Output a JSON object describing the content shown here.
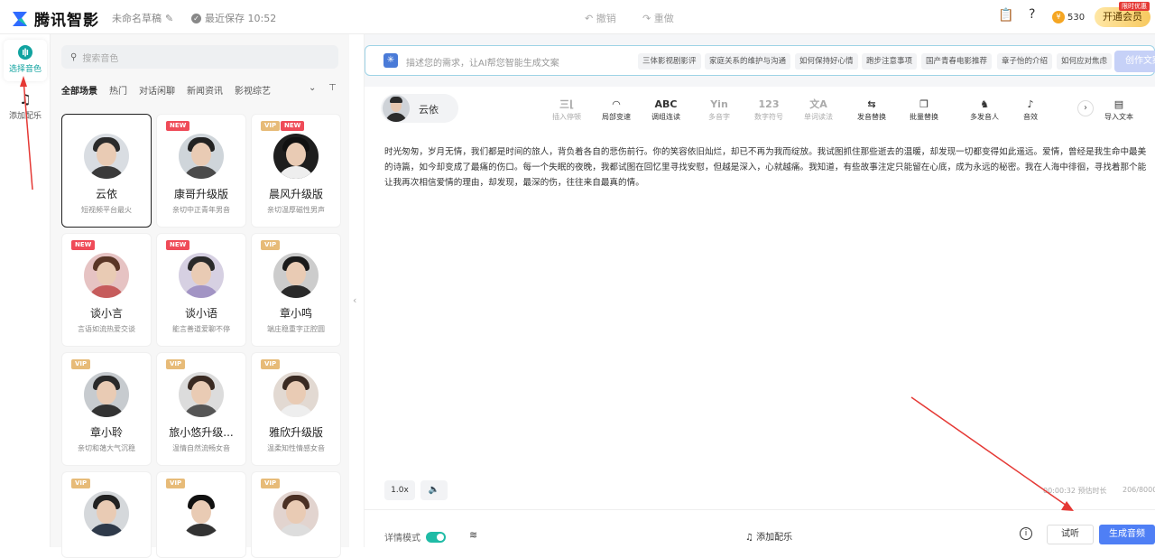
{
  "header": {
    "brand": "腾讯智影",
    "draft_name": "未命名草稿",
    "save_status": "最近保存 10:52",
    "undo": "撤销",
    "redo": "重做",
    "coins": "530",
    "vip_button": "开通会员",
    "vip_tag": "限时优惠"
  },
  "leftnav": {
    "items": [
      {
        "label": "选择音色",
        "icon": "voice-icon",
        "active": true
      },
      {
        "label": "添加配乐",
        "icon": "music-note-icon",
        "active": false
      }
    ]
  },
  "voices": {
    "search_placeholder": "搜索音色",
    "filters": [
      "全部场景",
      "热门",
      "对话闲聊",
      "新闻资讯",
      "影视综艺"
    ],
    "cards": [
      {
        "name": "云依",
        "desc": "短视频平台最火",
        "badges": [],
        "selected": true
      },
      {
        "name": "康哥升级版",
        "desc": "亲切中正青年男音",
        "badges": [
          "NEW"
        ]
      },
      {
        "name": "晨风升级版",
        "desc": "亲切温厚磁性男声",
        "badges": [
          "VIP",
          "NEW"
        ]
      },
      {
        "name": "谈小言",
        "desc": "言语如流热爱交谈",
        "badges": [
          "NEW"
        ]
      },
      {
        "name": "谈小语",
        "desc": "能言善道爱聊不停",
        "badges": [
          "NEW"
        ]
      },
      {
        "name": "章小鸣",
        "desc": "端庄稳重字正腔圆",
        "badges": [
          "VIP"
        ]
      },
      {
        "name": "章小聆",
        "desc": "亲切和蔼大气沉稳",
        "badges": [
          "VIP"
        ]
      },
      {
        "name": "旅小悠升级...",
        "desc": "温情自然流畅女音",
        "badges": [
          "VIP"
        ]
      },
      {
        "name": "雅欣升级版",
        "desc": "温柔知性情感女音",
        "badges": [
          "VIP"
        ]
      },
      {
        "name": "",
        "desc": "",
        "badges": [
          "VIP"
        ]
      },
      {
        "name": "",
        "desc": "",
        "badges": [
          "VIP"
        ]
      },
      {
        "name": "",
        "desc": "",
        "badges": [
          "VIP"
        ]
      }
    ]
  },
  "ai": {
    "placeholder": "描述您的需求，让AI帮您智能生成文案",
    "chips": [
      "三体影视剧影评",
      "家庭关系的维护与沟通",
      "如何保持好心情",
      "跑步注意事项",
      "国产青春电影推荐",
      "章子怡的介绍",
      "如何应对焦虑"
    ],
    "button": "创作文案"
  },
  "editor": {
    "speaker": "云依",
    "tools": [
      {
        "icon": "pause-insert-icon",
        "glyph": "三⌊",
        "label": "插入停顿",
        "dim": true
      },
      {
        "icon": "speed-gauge-icon",
        "glyph": "◠",
        "label": "局部变速",
        "dim": false
      },
      {
        "icon": "abc-icon",
        "glyph": "ABC",
        "label": "调组连读",
        "dim": false
      },
      {
        "icon": "pinyin-icon",
        "glyph": "Yin",
        "label": "多音字",
        "dim": true
      },
      {
        "icon": "number-icon",
        "glyph": "123",
        "label": "数字符号",
        "dim": true
      },
      {
        "icon": "translate-icon",
        "glyph": "文A",
        "label": "单词读法",
        "dim": true
      },
      {
        "icon": "swap-icon",
        "glyph": "⇆",
        "label": "发音替换",
        "dim": false
      },
      {
        "icon": "copy-icon",
        "glyph": "❐",
        "label": "批量替换",
        "dim": false
      },
      {
        "icon": "multi-speaker-icon",
        "glyph": "♞",
        "label": "多发音人",
        "dim": false
      },
      {
        "icon": "sound-effect-icon",
        "glyph": "♪",
        "label": "音效",
        "dim": false
      },
      {
        "icon": "import-icon",
        "glyph": "▤",
        "label": "导入文本",
        "dim": false
      }
    ],
    "text": "时光匆匆，岁月无情，我们都是时间的旅人，背负着各自的悲伤前行。你的笑容依旧灿烂，却已不再为我而绽放。我试图抓住那些逝去的温暖，却发现一切都变得如此遥远。爱情，曾经是我生命中最美的诗篇，如今却变成了最痛的伤口。每一个失眠的夜晚，我都试图在回忆里寻找安慰，但越是深入，心就越痛。我知道，有些故事注定只能留在心底，成为永远的秘密。我在人海中徘徊，寻找着那个能让我再次相信爱情的理由，却发现，最深的伤，往往来自最真的情。",
    "speed": "1.0x",
    "duration": "00:00:32  预估时长",
    "char_count": "206/8000"
  },
  "footer": {
    "detail_mode": "详情模式",
    "add_music": "添加配乐",
    "try_listen": "试听",
    "generate": "生成音频"
  }
}
